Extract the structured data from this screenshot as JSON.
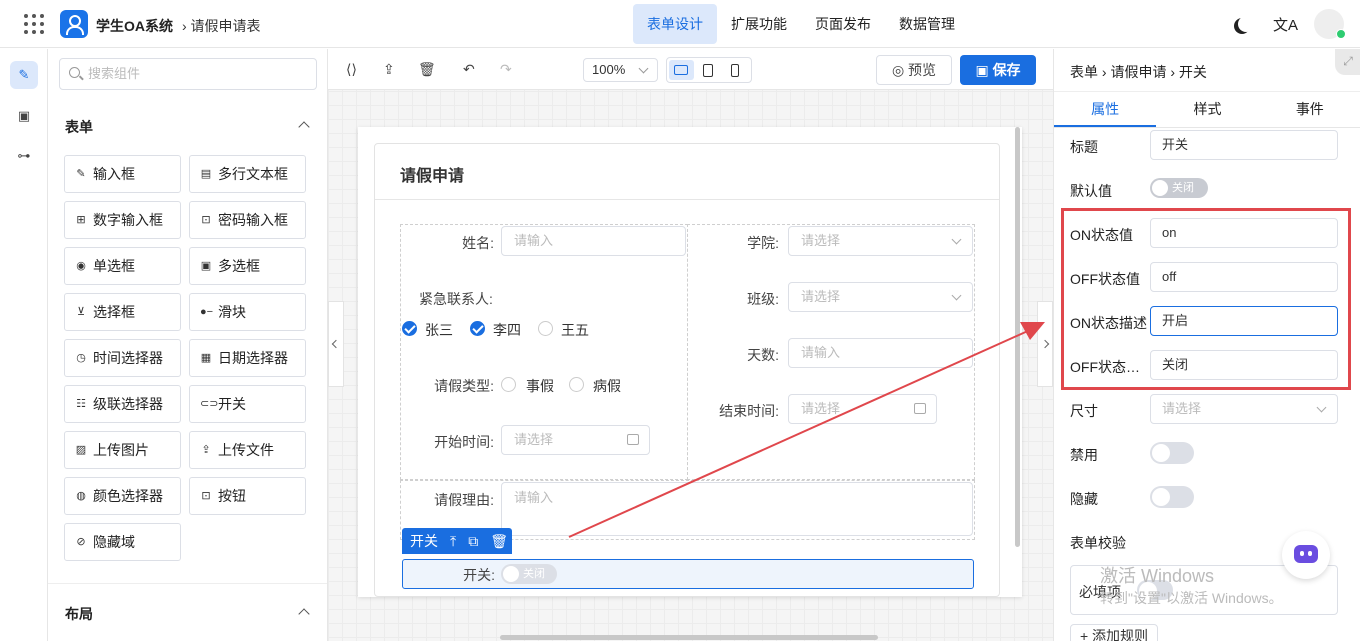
{
  "header": {
    "app_name": "学生OA系统",
    "breadcrumb": "› 请假申请表",
    "tabs": [
      {
        "label": "表单设计",
        "active": true
      },
      {
        "label": "扩展功能"
      },
      {
        "label": "页面发布"
      },
      {
        "label": "数据管理"
      }
    ],
    "translate_glyph": "文A"
  },
  "palette": {
    "search_placeholder": "搜索组件",
    "section_form": "表单",
    "section_layout": "布局",
    "components": [
      {
        "label": "输入框",
        "icon": "pencil-icon"
      },
      {
        "label": "多行文本框",
        "icon": "textarea-icon"
      },
      {
        "label": "数字输入框",
        "icon": "number-icon"
      },
      {
        "label": "密码输入框",
        "icon": "lock-icon"
      },
      {
        "label": "单选框",
        "icon": "radio-icon"
      },
      {
        "label": "多选框",
        "icon": "checkbox-icon"
      },
      {
        "label": "选择框",
        "icon": "select-icon"
      },
      {
        "label": "滑块",
        "icon": "slider-icon"
      },
      {
        "label": "时间选择器",
        "icon": "clock-icon"
      },
      {
        "label": "日期选择器",
        "icon": "calendar-icon"
      },
      {
        "label": "级联选择器",
        "icon": "cascader-icon"
      },
      {
        "label": "开关",
        "icon": "toggle-icon"
      },
      {
        "label": "上传图片",
        "icon": "image-icon"
      },
      {
        "label": "上传文件",
        "icon": "upload-icon"
      },
      {
        "label": "颜色选择器",
        "icon": "palette-icon"
      },
      {
        "label": "按钮",
        "icon": "button-icon"
      },
      {
        "label": "隐藏域",
        "icon": "eye-off-icon"
      }
    ]
  },
  "toolbar": {
    "zoom": "100%",
    "preview_label": "预览",
    "save_label": "保存"
  },
  "form": {
    "title": "请假申请",
    "name_label": "姓名:",
    "name_placeholder": "请输入",
    "college_label": "学院:",
    "college_placeholder": "请选择",
    "contact_label": "紧急联系人:",
    "contacts": [
      {
        "label": "张三",
        "checked": true
      },
      {
        "label": "李四",
        "checked": true
      },
      {
        "label": "王五",
        "checked": false
      }
    ],
    "class_label": "班级:",
    "class_placeholder": "请选择",
    "days_label": "天数:",
    "days_placeholder": "请输入",
    "leave_type_label": "请假类型:",
    "leave_types": [
      "事假",
      "病假"
    ],
    "end_label": "结束时间:",
    "end_placeholder": "请选择",
    "start_label": "开始时间:",
    "start_placeholder": "请选择",
    "reason_label": "请假理由:",
    "reason_placeholder": "请输入",
    "selected_name": "开关",
    "switch_label": "开关:",
    "switch_text": "关闭"
  },
  "props": {
    "breadcrumb": "表单 › 请假申请 › 开关",
    "tabs": [
      {
        "label": "属性",
        "active": true
      },
      {
        "label": "样式"
      },
      {
        "label": "事件"
      }
    ],
    "title_label": "标题",
    "title_value": "开关",
    "default_label": "默认值",
    "default_text": "关闭",
    "on_value_label": "ON状态值",
    "on_value": "on",
    "off_value_label": "OFF状态值",
    "off_value": "off",
    "on_desc_label": "ON状态描述",
    "on_desc": "开启",
    "off_desc_label": "OFF状态描...",
    "off_desc": "关闭",
    "size_label": "尺寸",
    "size_placeholder": "请选择",
    "disabled_label": "禁用",
    "hidden_label": "隐藏",
    "validation_label": "表单校验",
    "required_label": "必填项",
    "add_rule": "+ 添加规则"
  },
  "watermark": {
    "line1": "激活 Windows",
    "line2": "转到\"设置\"以激活 Windows。"
  },
  "colors": {
    "accent": "#1a6ee0",
    "highlight": "#e0474c"
  }
}
